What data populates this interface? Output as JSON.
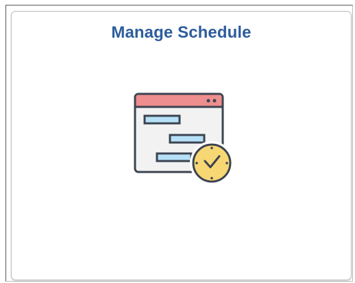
{
  "tile": {
    "title": "Manage Schedule",
    "icon": "schedule-clock-icon"
  },
  "colors": {
    "title": "#2d5d9c",
    "window_header": "#ee8e8e",
    "window_body": "#f2f2f2",
    "bars": "#b5e0f7",
    "clock_face": "#f7d774",
    "outline": "#3b4350"
  }
}
